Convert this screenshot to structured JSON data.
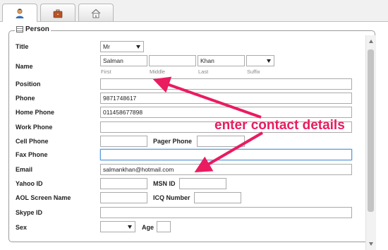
{
  "tabs": [
    {
      "icon": "user-icon",
      "active": true
    },
    {
      "icon": "briefcase-icon",
      "active": false
    },
    {
      "icon": "home-icon",
      "active": false
    }
  ],
  "section": {
    "title": "Person",
    "icon": "list-icon"
  },
  "form": {
    "title": {
      "label": "Title",
      "value": "Mr"
    },
    "name": {
      "label": "Name",
      "first": {
        "value": "Salman",
        "caption": "First"
      },
      "middle": {
        "value": "",
        "caption": "Middle"
      },
      "last": {
        "value": "Khan",
        "caption": "Last"
      },
      "suffix": {
        "value": "",
        "caption": "Suffix"
      }
    },
    "position": {
      "label": "Position",
      "value": ""
    },
    "phone": {
      "label": "Phone",
      "value": "9871748617"
    },
    "home_phone": {
      "label": "Home Phone",
      "value": "011458677898"
    },
    "work_phone": {
      "label": "Work Phone",
      "value": ""
    },
    "cell_phone": {
      "label": "Cell Phone",
      "value": ""
    },
    "pager_phone": {
      "label": "Pager Phone",
      "value": ""
    },
    "fax_phone": {
      "label": "Fax Phone",
      "value": ""
    },
    "email": {
      "label": "Email",
      "value": "salmankhan@hotmail.com"
    },
    "yahoo_id": {
      "label": "Yahoo ID",
      "value": ""
    },
    "msn_id": {
      "label": "MSN ID",
      "value": ""
    },
    "aol_screen_name": {
      "label": "AOL Screen Name",
      "value": ""
    },
    "icq_number": {
      "label": "ICQ Number",
      "value": ""
    },
    "skype_id": {
      "label": "Skype ID",
      "value": ""
    },
    "sex": {
      "label": "Sex",
      "value": ""
    },
    "age": {
      "label": "Age",
      "value": ""
    }
  },
  "annotation": {
    "text": "enter contact details",
    "color": "#ea1b5f"
  }
}
